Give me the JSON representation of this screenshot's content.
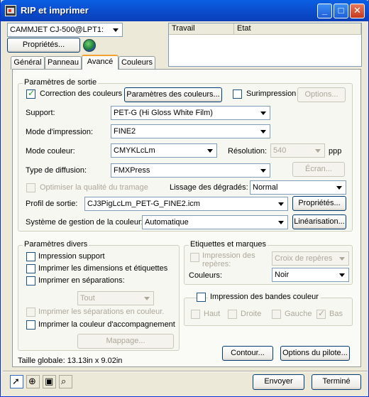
{
  "window": {
    "title": "RIP et imprimer",
    "minimize": "_",
    "maximize": "□",
    "close": "✕"
  },
  "printer": {
    "selected": "CAMMJET CJ-500@LPT1:"
  },
  "properties_button": "Propriétés...",
  "queue": {
    "col_job": "Travail",
    "col_state": "Etat"
  },
  "tabs": [
    "Général",
    "Panneau",
    "Avancé",
    "Couleurs"
  ],
  "output": {
    "group_title": "Paramètres de sortie",
    "color_correction_label": "Correction des couleurs",
    "color_correction_checked": true,
    "color_params_button": "Paramètres des couleurs...",
    "overprint_label": "Surimpression",
    "overprint_checked": false,
    "options_button": "Options...",
    "support_label": "Support:",
    "support_value": "PET-G (Hi Gloss White Film)",
    "print_mode_label": "Mode d'impression:",
    "print_mode_value": "FINE2",
    "color_mode_label": "Mode couleur:",
    "color_mode_value": "CMYKLcLm",
    "resolution_label": "Résolution:",
    "resolution_value": "540",
    "resolution_unit": "ppp",
    "diffusion_label": "Type de diffusion:",
    "diffusion_value": "FMXPress",
    "screen_button": "Écran...",
    "optimize_label": "Optimiser la qualité du tramage",
    "smoothing_label": "Lissage des dégradés:",
    "smoothing_value": "Normal",
    "profile_label": "Profil de sortie:",
    "profile_value": "CJ3PigLcLm_PET-G_FINE2.icm",
    "profile_props_button": "Propriétés...",
    "cms_label": "Système de gestion de la couleur:",
    "cms_value": "Automatique",
    "linearization_button": "Linéarisation..."
  },
  "misc": {
    "group_title": "Paramètres divers",
    "print_support": "Impression support",
    "print_dims": "Imprimer les dimensions et étiquettes",
    "print_separations": "Imprimer en séparations:",
    "separations_value": "Tout",
    "print_sep_color": "Imprimer les séparations en couleur.",
    "print_spot": "Imprimer la couleur d'accompagnement",
    "mapping_button": "Mappage..."
  },
  "labels": {
    "group_title": "Etiquettes et marques",
    "marks_print_label": "Impression des repères:",
    "marks_value": "Croix de repères",
    "colors_label": "Couleurs:",
    "colors_value": "Noir"
  },
  "bands": {
    "title": "Impression des bandes couleur",
    "top": "Haut",
    "right": "Droite",
    "left": "Gauche",
    "bottom": "Bas"
  },
  "total_size": "Taille globale:  13.13in x  9.02in",
  "contour_button": "Contour...",
  "driver_options_button": "Options du pilote...",
  "send_button": "Envoyer",
  "done_button": "Terminé",
  "tools": [
    "arrow-tool",
    "zoom-tool",
    "image-tool",
    "preview-tool"
  ]
}
